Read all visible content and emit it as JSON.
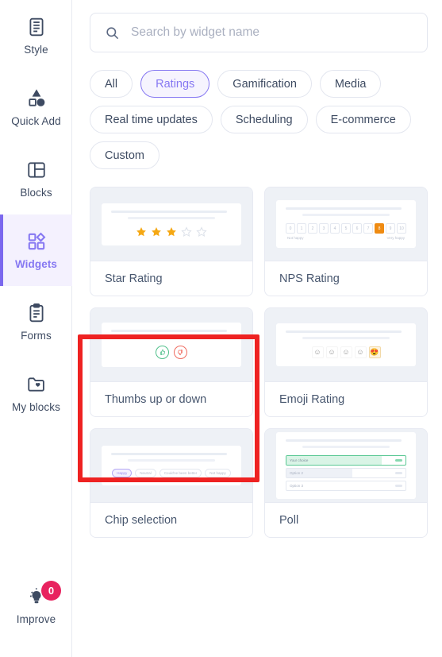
{
  "sidebar": {
    "items": [
      {
        "label": "Style",
        "icon": "style-icon",
        "active": false
      },
      {
        "label": "Quick Add",
        "icon": "quick-add-icon",
        "active": false
      },
      {
        "label": "Blocks",
        "icon": "blocks-icon",
        "active": false
      },
      {
        "label": "Widgets",
        "icon": "widgets-icon",
        "active": true
      },
      {
        "label": "Forms",
        "icon": "forms-icon",
        "active": false
      },
      {
        "label": "My blocks",
        "icon": "my-blocks-icon",
        "active": false
      }
    ],
    "improve": {
      "label": "Improve",
      "icon": "lightbulb-icon",
      "badge": "0"
    },
    "active_color": "#8678f2",
    "badge_color": "#e8235f"
  },
  "search": {
    "placeholder": "Search by widget name",
    "value": "",
    "icon": "search-icon"
  },
  "filters": {
    "selected": "Ratings",
    "chips": [
      "All",
      "Ratings",
      "Gamification",
      "Media",
      "Real time updates",
      "Scheduling",
      "E-commerce",
      "Custom"
    ]
  },
  "widgets": [
    {
      "name": "Star Rating",
      "preview": "stars",
      "stars_filled": 3,
      "stars_total": 5,
      "star_color": "#f5a814"
    },
    {
      "name": "NPS Rating",
      "preview": "nps",
      "scale": [
        "0",
        "1",
        "2",
        "3",
        "4",
        "5",
        "6",
        "7",
        "8",
        "9",
        "10"
      ],
      "selected_value": "8",
      "low_label": "Not happy",
      "high_label": "Very happy",
      "accent": "#ef8b12"
    },
    {
      "name": "Thumbs up or down",
      "preview": "thumbs",
      "up_color": "#4fc08a",
      "down_color": "#ef6a5e",
      "highlighted": true
    },
    {
      "name": "Emoji Rating",
      "preview": "emoji",
      "emojis": [
        "☺",
        "☺",
        "☺",
        "☺",
        "😍"
      ],
      "selected_index": 4
    },
    {
      "name": "Chip selection",
      "preview": "chips",
      "options": [
        "Happy",
        "Neutral",
        "Could've been better",
        "Not happy"
      ],
      "selected_index": 0
    },
    {
      "name": "Poll",
      "preview": "poll",
      "options": [
        {
          "label": "Your choice",
          "fill": 80,
          "selected": true
        },
        {
          "label": "Option 2",
          "fill": 55,
          "selected": false
        },
        {
          "label": "Option 3",
          "fill": 0,
          "selected": false
        }
      ],
      "accent": "#5ac894"
    }
  ],
  "annotation": {
    "color": "#ee2222",
    "target": "Thumbs up or down"
  }
}
